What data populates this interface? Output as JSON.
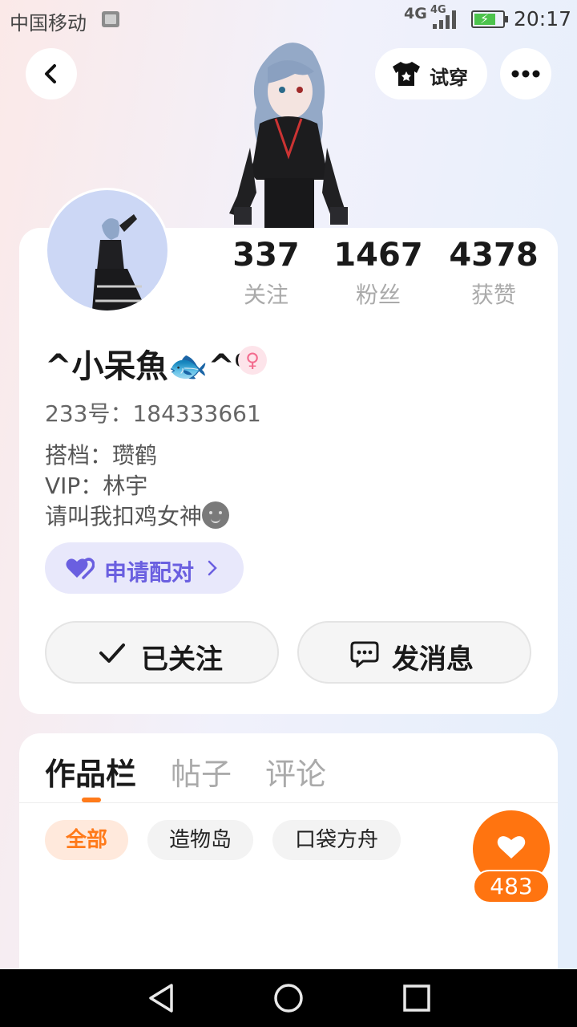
{
  "status_bar": {
    "carrier": "中国移动",
    "network_a": "4G",
    "network_b": "4G",
    "time": "20:17",
    "icons": [
      "sim-icon",
      "signal-icon",
      "battery-charging-icon"
    ]
  },
  "header": {
    "try_on_label": "试穿",
    "icons": [
      "back-icon",
      "tshirt-icon",
      "more-icon"
    ]
  },
  "profile": {
    "stats": [
      {
        "value": "337",
        "label": "关注"
      },
      {
        "value": "1467",
        "label": "粉丝"
      },
      {
        "value": "4378",
        "label": "获赞"
      }
    ],
    "nickname": "^小呆魚🐟^⁰",
    "gender_symbol": "♀",
    "uid_line": "233号：184333661",
    "bio_lines": [
      "搭档：瓒鹤",
      "VIP：林宇",
      "请叫我扣鸡女神"
    ],
    "pair_label": "申请配对",
    "follow_label": "已关注",
    "message_label": "发消息"
  },
  "works": {
    "tabs": [
      "作品栏",
      "帖子",
      "评论"
    ],
    "active_tab": 0,
    "chips": [
      "全部",
      "造物岛",
      "口袋方舟"
    ],
    "active_chip": 0,
    "like_count": "483"
  },
  "colors": {
    "accent_orange": "#ff7410",
    "pair_purple": "#6a5fe0",
    "stat_label_gray": "#aaaaaa"
  }
}
